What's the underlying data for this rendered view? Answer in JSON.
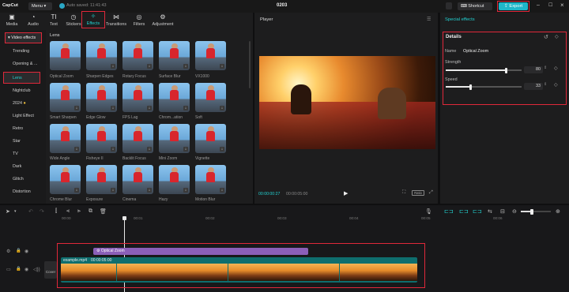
{
  "app": {
    "logo": "CapCut",
    "menu_label": "Menu",
    "autosave": "Auto saved: 11:41:43",
    "project_title": "0203",
    "shortcut_label": "Shortcut",
    "export_label": "Export"
  },
  "colors": {
    "accent": "#22d3d3",
    "highlight": "#e0283a",
    "export_bg": "#1fb6c9",
    "clip_track": "#0e6e6e",
    "effect_bar": "#8b5fb8"
  },
  "toolbar": {
    "items": [
      {
        "label": "Media",
        "icon": "media-icon"
      },
      {
        "label": "Audio",
        "icon": "audio-icon"
      },
      {
        "label": "Text",
        "icon": "text-icon"
      },
      {
        "label": "Stickers",
        "icon": "stickers-icon"
      },
      {
        "label": "Effects",
        "icon": "effects-icon"
      },
      {
        "label": "Transitions",
        "icon": "transitions-icon"
      },
      {
        "label": "Filters",
        "icon": "filters-icon"
      },
      {
        "label": "Adjustment",
        "icon": "adjustment-icon"
      }
    ]
  },
  "sidebar": {
    "items": [
      "Video effects",
      "Trending",
      "Opening & ...",
      "Lens",
      "Nightclub",
      "2024",
      "Light Effect",
      "Retro",
      "Star",
      "TV",
      "Dark",
      "Glitch",
      "Distortion"
    ]
  },
  "gallery": {
    "section_title": "Lens",
    "effects": [
      "Optical Zoom",
      "Sharpen Edges",
      "Rotary Focus",
      "Surface Blur",
      "VX1000",
      "Smart Sharpen",
      "Edge Glow",
      "FPS Lag",
      "Chrom...ation",
      "Soft",
      "Wide Angle",
      "Fisheye II",
      "Backlit Focus",
      "Mini Zoom",
      "Vignette",
      "Chrome Blur",
      "Exposure",
      "Cinema",
      "Hazy",
      "Motion Blur"
    ]
  },
  "player": {
    "title": "Player",
    "current_time": "00:00:00:27",
    "total_time": "00:00:05:00",
    "ratio_label": "Ratio"
  },
  "details": {
    "panel_title": "Special effects",
    "section_title": "Details",
    "name_label": "Name",
    "name_value": "Optical Zoom",
    "strength_label": "Strength",
    "strength_value": "80",
    "speed_label": "Speed",
    "speed_value": "33"
  },
  "timeline": {
    "ruler": [
      "00:00",
      "00:01",
      "00:02",
      "00:03",
      "00:04",
      "00:05",
      "00:06"
    ],
    "effect_clip": "Optical Zoom",
    "video_clip_name": "example.mp4",
    "video_clip_duration": "00:00:05:00",
    "cover_label": "Cover"
  }
}
